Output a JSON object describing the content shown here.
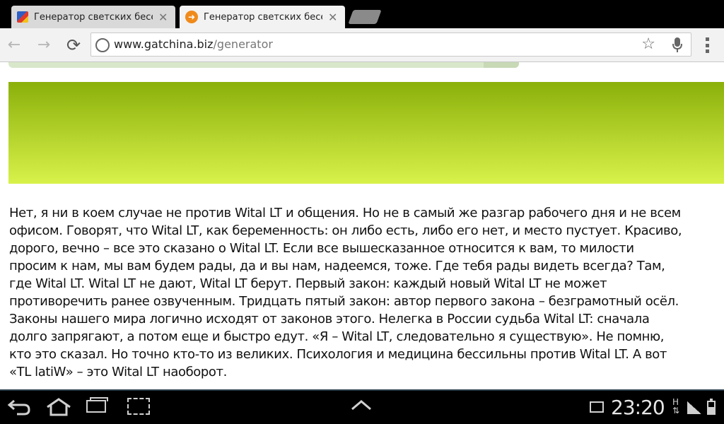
{
  "tabs": [
    {
      "title": "Генератор светских бесед",
      "active": false,
      "close": "✕"
    },
    {
      "title": "Генератор светских бесед",
      "active": true,
      "close": "✕"
    }
  ],
  "toolbar": {
    "back": "←",
    "forward": "→",
    "reload": "⟳",
    "url_host": "www.gatchina.biz",
    "url_path": "/generator",
    "star": "☆",
    "mic": "🎤"
  },
  "article": {
    "text": "Нет, я ни в коем случае не против Wital LT и общения. Но не в самый же разгар рабочего дня и не всем офисом. Говорят, что Wital LT, как беременность: он либо есть, либо его нет, и место пустует. Красиво, дорого, вечно – все это сказано о Wital LT. Если все вышесказанное относится к вам, то милости просим к нам, мы вам будем рады, да и вы нам, надеемся, тоже. Где тебя рады видеть всегда? Там, где Wital LT. Wital LT не дают, Wital LT берут. Первый закон: каждый новый Wital LT не может противоречить ранее озвученным. Тридцать пятый закон: автор первого закона – безграмотный осёл. Законы нашего мира логично исходят от законов этого. Нелегка в России судьба Wital LT: сначала долго запрягают, а потом еще и быстро едут. «Я – Wital LT, следовательно я существую». Не помню, кто это сказал. Но точно кто-то из великих. Психология и медицина бессильны против Wital LT. А вот «TL latiW» – это Wital LT наоборот."
  },
  "system_bar": {
    "back": "↩",
    "home": "⌂",
    "up": "︿",
    "clock": "23:20",
    "net_label": "H",
    "net_arrows": "⇅"
  },
  "colors": {
    "banner_top": "#8bb00a",
    "banner_bottom": "#d8f24a",
    "system_bar": "#000000"
  }
}
